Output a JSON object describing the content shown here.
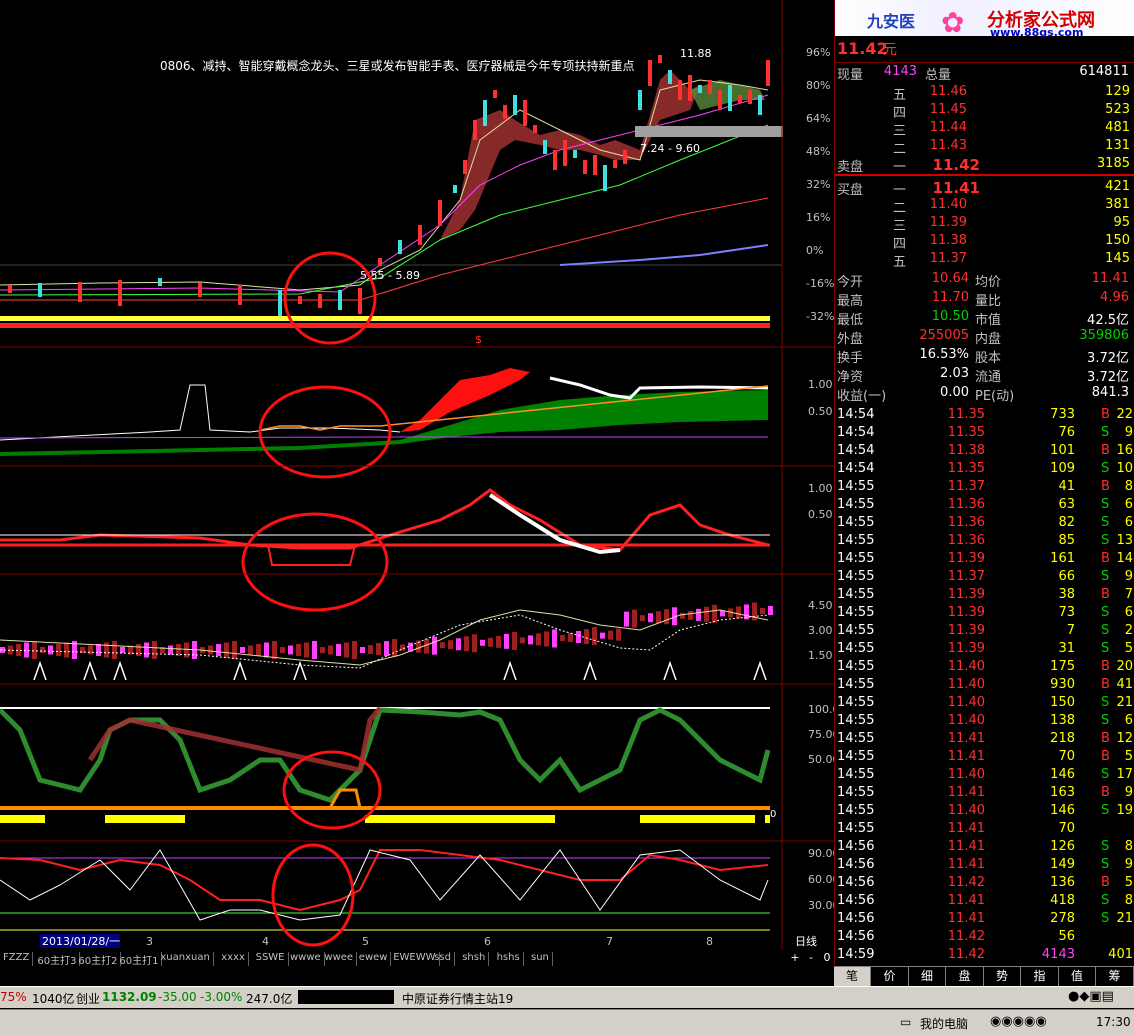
{
  "header": {
    "price": "11.42",
    "price_unit": "元",
    "logo_text": "九安医",
    "banner_title": "分析家公式网",
    "banner_url": "www.88gs.com"
  },
  "chart": {
    "annotation": "0806、减持、智能穿戴概念龙头、三星或发布智能手表、医疗器械是今年专项扶持新重点",
    "main_axis": [
      "96%",
      "80%",
      "64%",
      "48%",
      "32%",
      "16%",
      "0%",
      "-16%",
      "-32%"
    ],
    "high_label": "11.88",
    "mid_label": "7.24 - 9.60",
    "low_label": "5.55 - 5.89",
    "marker_s": "$",
    "p2_axis": [
      "1.00",
      "0.50"
    ],
    "p3_axis": [
      "1.00",
      "0.50"
    ],
    "p4_axis": [
      "4.50",
      "3.00",
      "1.50"
    ],
    "p5_axis": [
      "100.0",
      "75.00",
      "50.00"
    ],
    "p6_axis": [
      "90.00",
      "60.00",
      "30.00"
    ],
    "p5_end_label": "0",
    "date_label": "2013/01/28/一",
    "month_ticks": [
      "3",
      "4",
      "5",
      "6",
      "7",
      "8"
    ],
    "daily_label": "日线"
  },
  "quote": {
    "now_label": "现量",
    "now_val": "4143",
    "total_label": "总量",
    "total_val": "614811",
    "asks": [
      {
        "lv": "五",
        "price": "11.46",
        "vol": "129"
      },
      {
        "lv": "四",
        "price": "11.45",
        "vol": "523"
      },
      {
        "lv": "三",
        "price": "11.44",
        "vol": "481"
      },
      {
        "lv": "二",
        "price": "11.43",
        "vol": "131"
      },
      {
        "lv": "一",
        "price": "11.42",
        "vol": "3185"
      }
    ],
    "sell_label": "卖盘",
    "buy_label": "买盘",
    "bids": [
      {
        "lv": "一",
        "price": "11.41",
        "vol": "421"
      },
      {
        "lv": "二",
        "price": "11.40",
        "vol": "381"
      },
      {
        "lv": "三",
        "price": "11.39",
        "vol": "95"
      },
      {
        "lv": "四",
        "price": "11.38",
        "vol": "150"
      },
      {
        "lv": "五",
        "price": "11.37",
        "vol": "145"
      }
    ],
    "stats": [
      {
        "l1": "今开",
        "v1": "10.64",
        "c1": "red",
        "l2": "均价",
        "v2": "11.41",
        "c2": "red"
      },
      {
        "l1": "最高",
        "v1": "11.70",
        "c1": "red",
        "l2": "量比",
        "v2": "4.96",
        "c2": "red"
      },
      {
        "l1": "最低",
        "v1": "10.50",
        "c1": "grn",
        "l2": "市值",
        "v2": "42.5亿",
        "c2": "wht"
      },
      {
        "l1": "外盘",
        "v1": "255005",
        "c1": "red",
        "l2": "内盘",
        "v2": "359806",
        "c2": "grn"
      },
      {
        "l1": "换手",
        "v1": "16.53%",
        "c1": "wht",
        "l2": "股本",
        "v2": "3.72亿",
        "c2": "wht"
      },
      {
        "l1": "净资",
        "v1": "2.03",
        "c1": "wht",
        "l2": "流通",
        "v2": "3.72亿",
        "c2": "wht"
      },
      {
        "l1": "收益(一)",
        "v1": "0.00",
        "c1": "wht",
        "l2": "PE(动)",
        "v2": "841.3",
        "c2": "wht"
      }
    ],
    "ticks": [
      [
        "14:54",
        "11.35",
        "733",
        "B",
        "22"
      ],
      [
        "14:54",
        "11.35",
        "76",
        "S",
        "9"
      ],
      [
        "14:54",
        "11.38",
        "101",
        "B",
        "16"
      ],
      [
        "14:54",
        "11.35",
        "109",
        "S",
        "10"
      ],
      [
        "14:55",
        "11.37",
        "41",
        "B",
        "8"
      ],
      [
        "14:55",
        "11.36",
        "63",
        "S",
        "6"
      ],
      [
        "14:55",
        "11.36",
        "82",
        "S",
        "6"
      ],
      [
        "14:55",
        "11.36",
        "85",
        "S",
        "13"
      ],
      [
        "14:55",
        "11.39",
        "161",
        "B",
        "14"
      ],
      [
        "14:55",
        "11.37",
        "66",
        "S",
        "9"
      ],
      [
        "14:55",
        "11.39",
        "38",
        "B",
        "7"
      ],
      [
        "14:55",
        "11.39",
        "73",
        "S",
        "6"
      ],
      [
        "14:55",
        "11.39",
        "7",
        "S",
        "2"
      ],
      [
        "14:55",
        "11.39",
        "31",
        "S",
        "5"
      ],
      [
        "14:55",
        "11.40",
        "175",
        "B",
        "20"
      ],
      [
        "14:55",
        "11.40",
        "930",
        "B",
        "41"
      ],
      [
        "14:55",
        "11.40",
        "150",
        "S",
        "21"
      ],
      [
        "14:55",
        "11.40",
        "138",
        "S",
        "6"
      ],
      [
        "14:55",
        "11.41",
        "218",
        "B",
        "12"
      ],
      [
        "14:55",
        "11.41",
        "70",
        "B",
        "5"
      ],
      [
        "14:55",
        "11.40",
        "146",
        "S",
        "17"
      ],
      [
        "14:55",
        "11.41",
        "163",
        "B",
        "9"
      ],
      [
        "14:55",
        "11.40",
        "146",
        "S",
        "19"
      ],
      [
        "14:55",
        "11.41",
        "70",
        "",
        ""
      ],
      [
        "14:56",
        "11.41",
        "126",
        "S",
        "8"
      ],
      [
        "14:56",
        "11.41",
        "149",
        "S",
        "9"
      ],
      [
        "14:56",
        "11.42",
        "136",
        "B",
        "5"
      ],
      [
        "14:56",
        "11.41",
        "418",
        "S",
        "8"
      ],
      [
        "14:56",
        "11.41",
        "278",
        "S",
        "21"
      ],
      [
        "14:56",
        "11.42",
        "56",
        "",
        ""
      ],
      [
        "14:59",
        "11.42",
        "4143",
        "",
        "401"
      ]
    ],
    "tabs": [
      "笔",
      "价",
      "细",
      "盘",
      "势",
      "指",
      "值",
      "筹"
    ]
  },
  "indicator_tabs": [
    "FZZZ",
    "60主打3",
    "60主打2",
    "60主打1",
    "xuanxuan",
    "xxxx",
    "SSWE",
    "wwwe",
    "wwee",
    "ewew",
    "EWEWW",
    "ssd",
    "shsh",
    "hshs",
    "sun"
  ],
  "nav_buttons": [
    "+",
    "-",
    "0"
  ],
  "status": {
    "pct1": "75%",
    "amt1": "1040亿",
    "board": "创业",
    "board_val": "1132.09",
    "board_chg": "-35.00",
    "board_pct": "-3.00%",
    "board_amt": "247.0亿",
    "broker": "中原证券行情主站19"
  },
  "taskbar": {
    "mycomputer": "我的电脑",
    "time": "17:30"
  }
}
